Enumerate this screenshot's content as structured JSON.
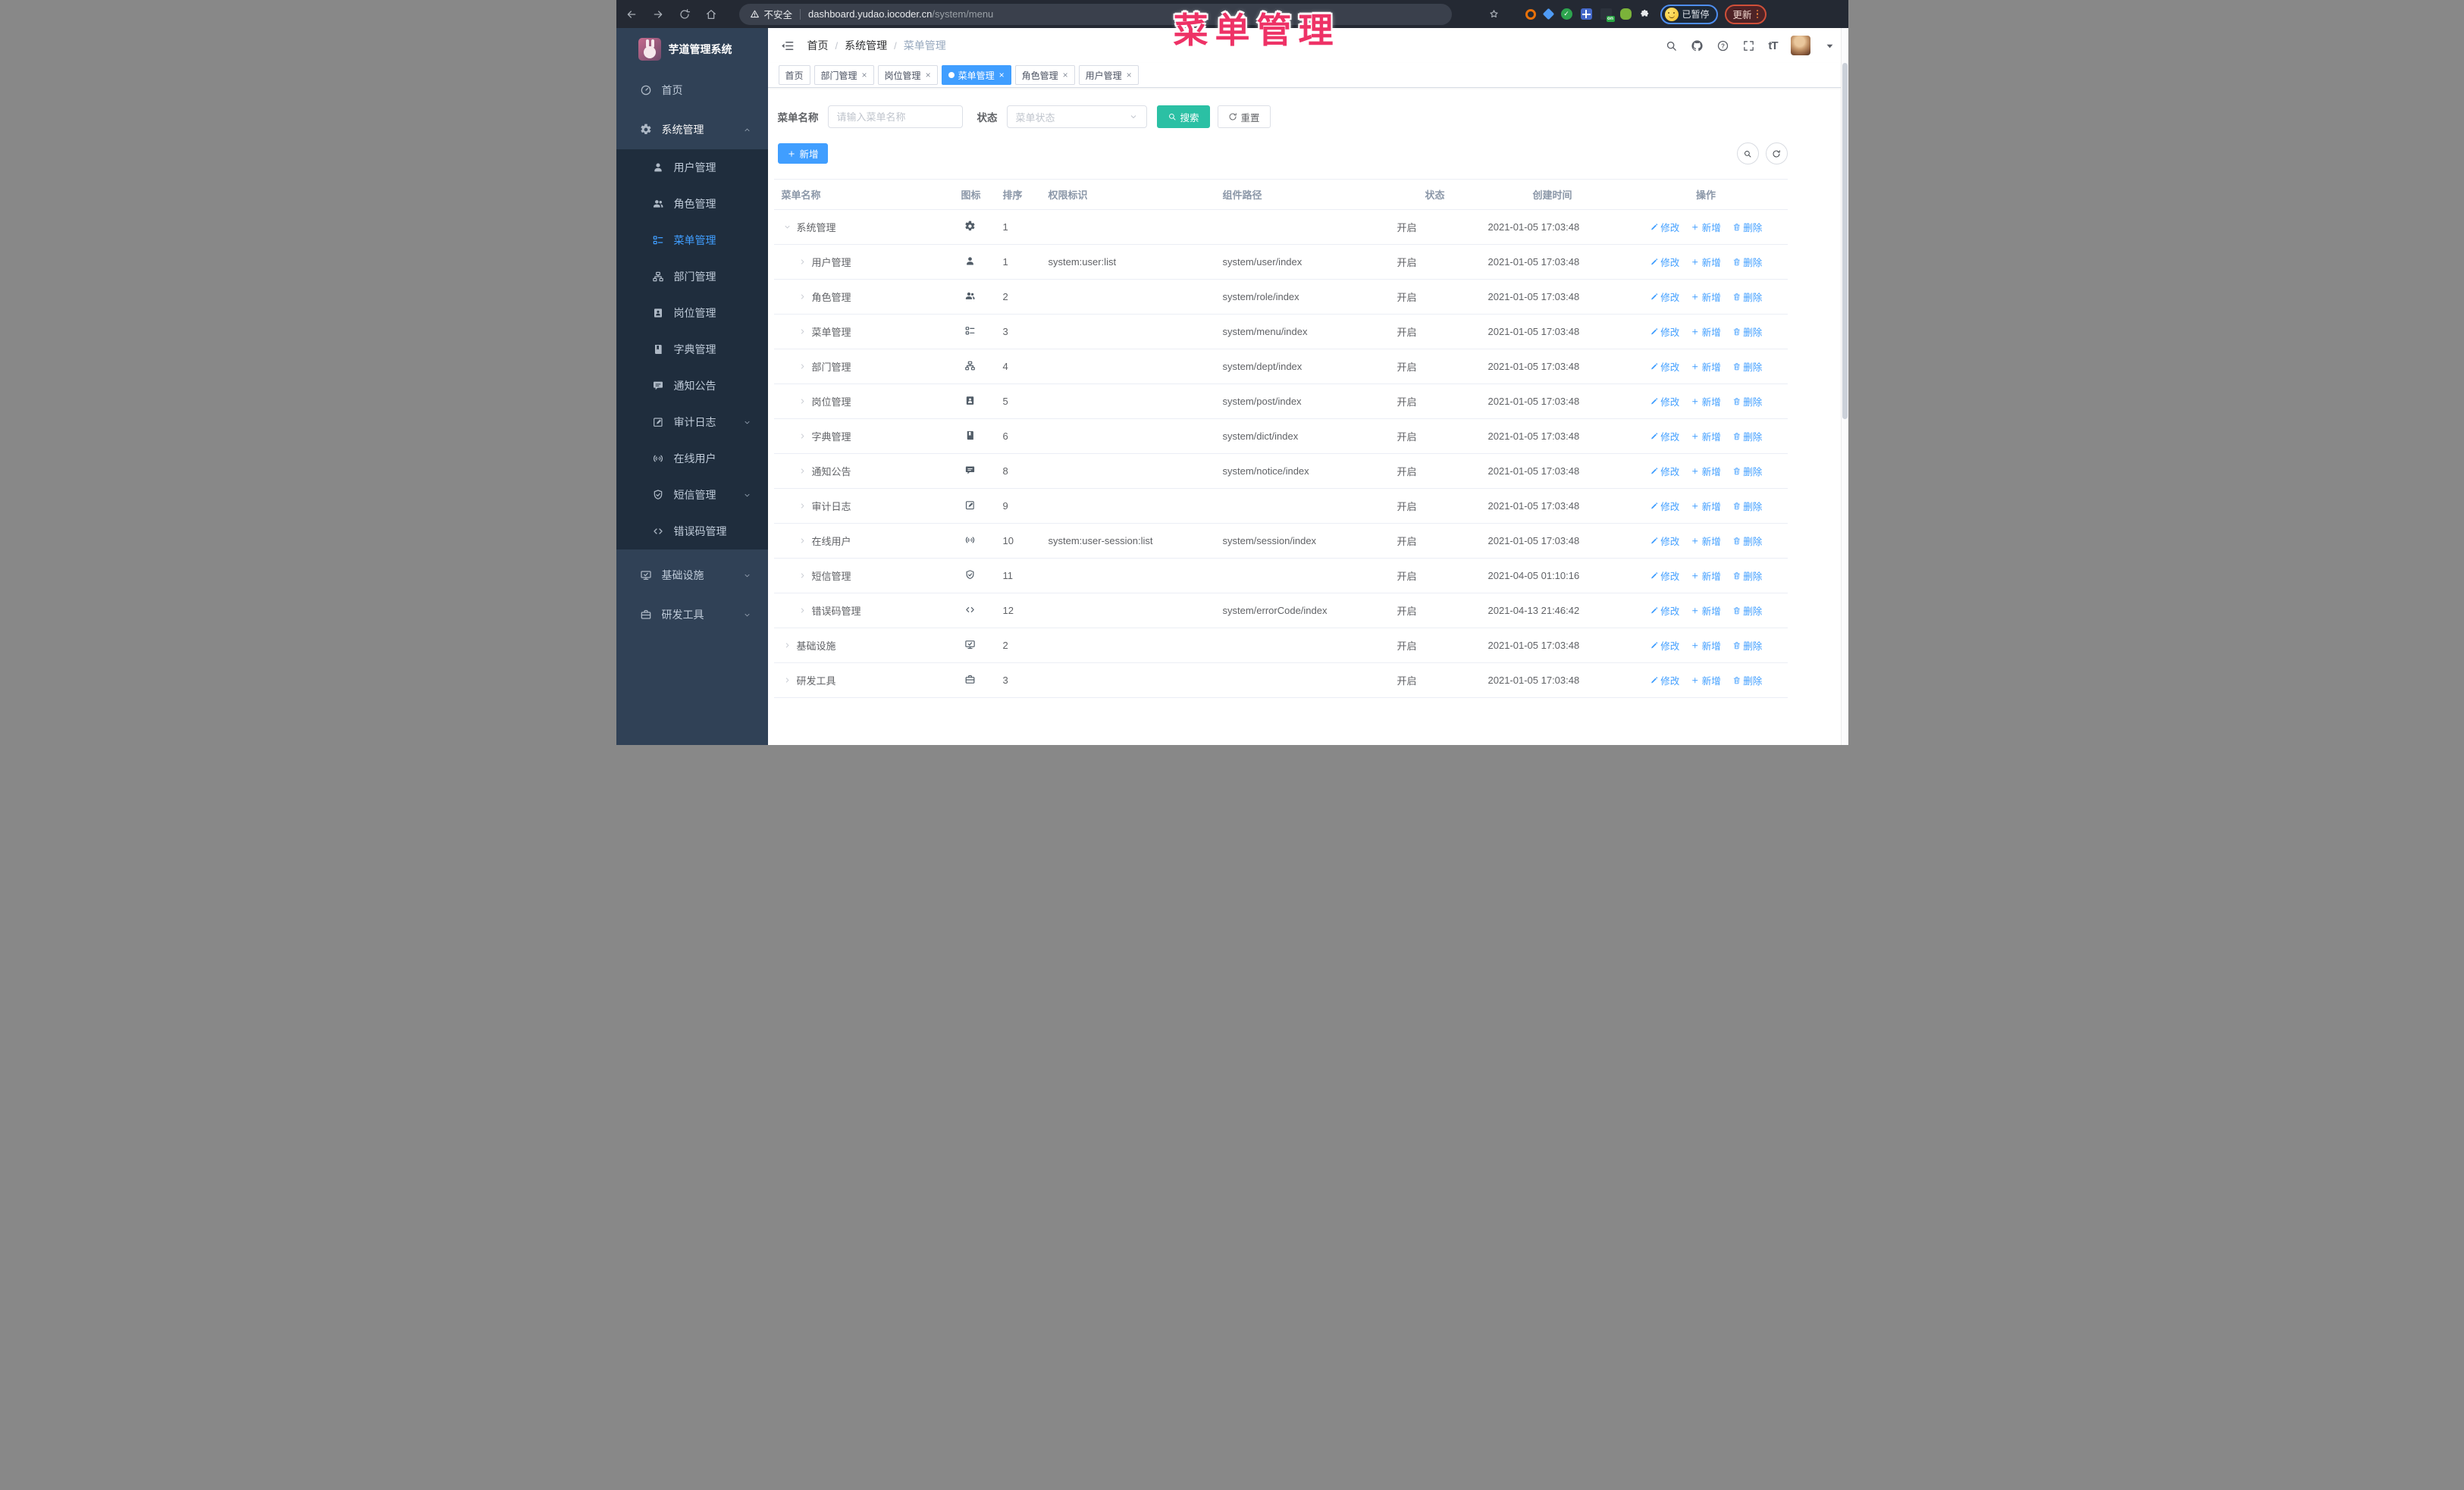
{
  "browser": {
    "security_label": "不安全",
    "url_host": "dashboard.yudao.iocoder.cn",
    "url_path": "/system/menu",
    "paused_badge": "已暂停",
    "update_button": "更新"
  },
  "overlay_title": "菜单管理",
  "colors": {
    "accent": "#409EFF",
    "search_button": "#2BC0A4",
    "overlay_title": "#EE3266",
    "sidebar_bg": "#304156",
    "submenu_bg": "#1F2D3D",
    "chrome_bg": "#242933"
  },
  "sidebar": {
    "app_title": "芋道管理系统",
    "items": [
      {
        "label": "首页",
        "icon": "dashboard",
        "type": "root"
      },
      {
        "label": "系统管理",
        "icon": "gear",
        "type": "root",
        "active": true,
        "arrow": "up"
      },
      {
        "label": "用户管理",
        "icon": "user",
        "type": "sub"
      },
      {
        "label": "角色管理",
        "icon": "users",
        "type": "sub"
      },
      {
        "label": "菜单管理",
        "icon": "tree-table",
        "type": "sub",
        "selected": true
      },
      {
        "label": "部门管理",
        "icon": "tree",
        "type": "sub"
      },
      {
        "label": "岗位管理",
        "icon": "badge",
        "type": "sub"
      },
      {
        "label": "字典管理",
        "icon": "dict",
        "type": "sub"
      },
      {
        "label": "通知公告",
        "icon": "message",
        "type": "sub"
      },
      {
        "label": "审计日志",
        "icon": "edit",
        "type": "sub",
        "arrow": "down"
      },
      {
        "label": "在线用户",
        "icon": "online",
        "type": "sub"
      },
      {
        "label": "短信管理",
        "icon": "shield",
        "type": "sub",
        "arrow": "down"
      },
      {
        "label": "错误码管理",
        "icon": "code",
        "type": "sub"
      },
      {
        "label": "基础设施",
        "icon": "monitor",
        "type": "root",
        "arrow": "down"
      },
      {
        "label": "研发工具",
        "icon": "tool",
        "type": "root",
        "arrow": "down"
      }
    ]
  },
  "header": {
    "breadcrumb": [
      "首页",
      "系统管理",
      "菜单管理"
    ],
    "font_icon_label": "tT"
  },
  "tabs": [
    {
      "label": "首页",
      "closable": false,
      "active": false
    },
    {
      "label": "部门管理",
      "closable": true,
      "active": false
    },
    {
      "label": "岗位管理",
      "closable": true,
      "active": false
    },
    {
      "label": "菜单管理",
      "closable": true,
      "active": true
    },
    {
      "label": "角色管理",
      "closable": true,
      "active": false
    },
    {
      "label": "用户管理",
      "closable": true,
      "active": false
    }
  ],
  "filters": {
    "name_label": "菜单名称",
    "name_placeholder": "请输入菜单名称",
    "name_value": "",
    "status_label": "状态",
    "status_placeholder": "菜单状态",
    "search_label": "搜索",
    "reset_label": "重置"
  },
  "toolbar": {
    "add_label": "新增"
  },
  "misc": {
    "close_glyph": "×",
    "breadcrumb_sep": "/"
  },
  "table": {
    "columns": [
      "菜单名称",
      "图标",
      "排序",
      "权限标识",
      "组件路径",
      "状态",
      "创建时间",
      "操作"
    ],
    "actions": {
      "edit": "修改",
      "add": "新增",
      "delete": "删除"
    },
    "rows": [
      {
        "name": "系统管理",
        "level": 0,
        "expanded": true,
        "icon": "gear",
        "order": "1",
        "perm": "",
        "path": "",
        "status": "开启",
        "time": "2021-01-05 17:03:48"
      },
      {
        "name": "用户管理",
        "level": 1,
        "expanded": false,
        "icon": "user",
        "order": "1",
        "perm": "system:user:list",
        "path": "system/user/index",
        "status": "开启",
        "time": "2021-01-05 17:03:48"
      },
      {
        "name": "角色管理",
        "level": 1,
        "expanded": false,
        "icon": "users",
        "order": "2",
        "perm": "",
        "path": "system/role/index",
        "status": "开启",
        "time": "2021-01-05 17:03:48"
      },
      {
        "name": "菜单管理",
        "level": 1,
        "expanded": false,
        "icon": "tree-table",
        "order": "3",
        "perm": "",
        "path": "system/menu/index",
        "status": "开启",
        "time": "2021-01-05 17:03:48"
      },
      {
        "name": "部门管理",
        "level": 1,
        "expanded": false,
        "icon": "tree",
        "order": "4",
        "perm": "",
        "path": "system/dept/index",
        "status": "开启",
        "time": "2021-01-05 17:03:48"
      },
      {
        "name": "岗位管理",
        "level": 1,
        "expanded": false,
        "icon": "badge",
        "order": "5",
        "perm": "",
        "path": "system/post/index",
        "status": "开启",
        "time": "2021-01-05 17:03:48"
      },
      {
        "name": "字典管理",
        "level": 1,
        "expanded": false,
        "icon": "dict",
        "order": "6",
        "perm": "",
        "path": "system/dict/index",
        "status": "开启",
        "time": "2021-01-05 17:03:48"
      },
      {
        "name": "通知公告",
        "level": 1,
        "expanded": false,
        "icon": "message",
        "order": "8",
        "perm": "",
        "path": "system/notice/index",
        "status": "开启",
        "time": "2021-01-05 17:03:48"
      },
      {
        "name": "审计日志",
        "level": 1,
        "expanded": false,
        "icon": "edit",
        "order": "9",
        "perm": "",
        "path": "",
        "status": "开启",
        "time": "2021-01-05 17:03:48"
      },
      {
        "name": "在线用户",
        "level": 1,
        "expanded": false,
        "icon": "online",
        "order": "10",
        "perm": "system:user-session:list",
        "path": "system/session/index",
        "status": "开启",
        "time": "2021-01-05 17:03:48"
      },
      {
        "name": "短信管理",
        "level": 1,
        "expanded": false,
        "icon": "shield",
        "order": "11",
        "perm": "",
        "path": "",
        "status": "开启",
        "time": "2021-04-05 01:10:16"
      },
      {
        "name": "错误码管理",
        "level": 1,
        "expanded": false,
        "icon": "code",
        "order": "12",
        "perm": "",
        "path": "system/errorCode/index",
        "status": "开启",
        "time": "2021-04-13 21:46:42"
      },
      {
        "name": "基础设施",
        "level": 0,
        "expanded": false,
        "icon": "monitor",
        "order": "2",
        "perm": "",
        "path": "",
        "status": "开启",
        "time": "2021-01-05 17:03:48"
      },
      {
        "name": "研发工具",
        "level": 0,
        "expanded": false,
        "icon": "tool",
        "order": "3",
        "perm": "",
        "path": "",
        "status": "开启",
        "time": "2021-01-05 17:03:48"
      }
    ]
  }
}
